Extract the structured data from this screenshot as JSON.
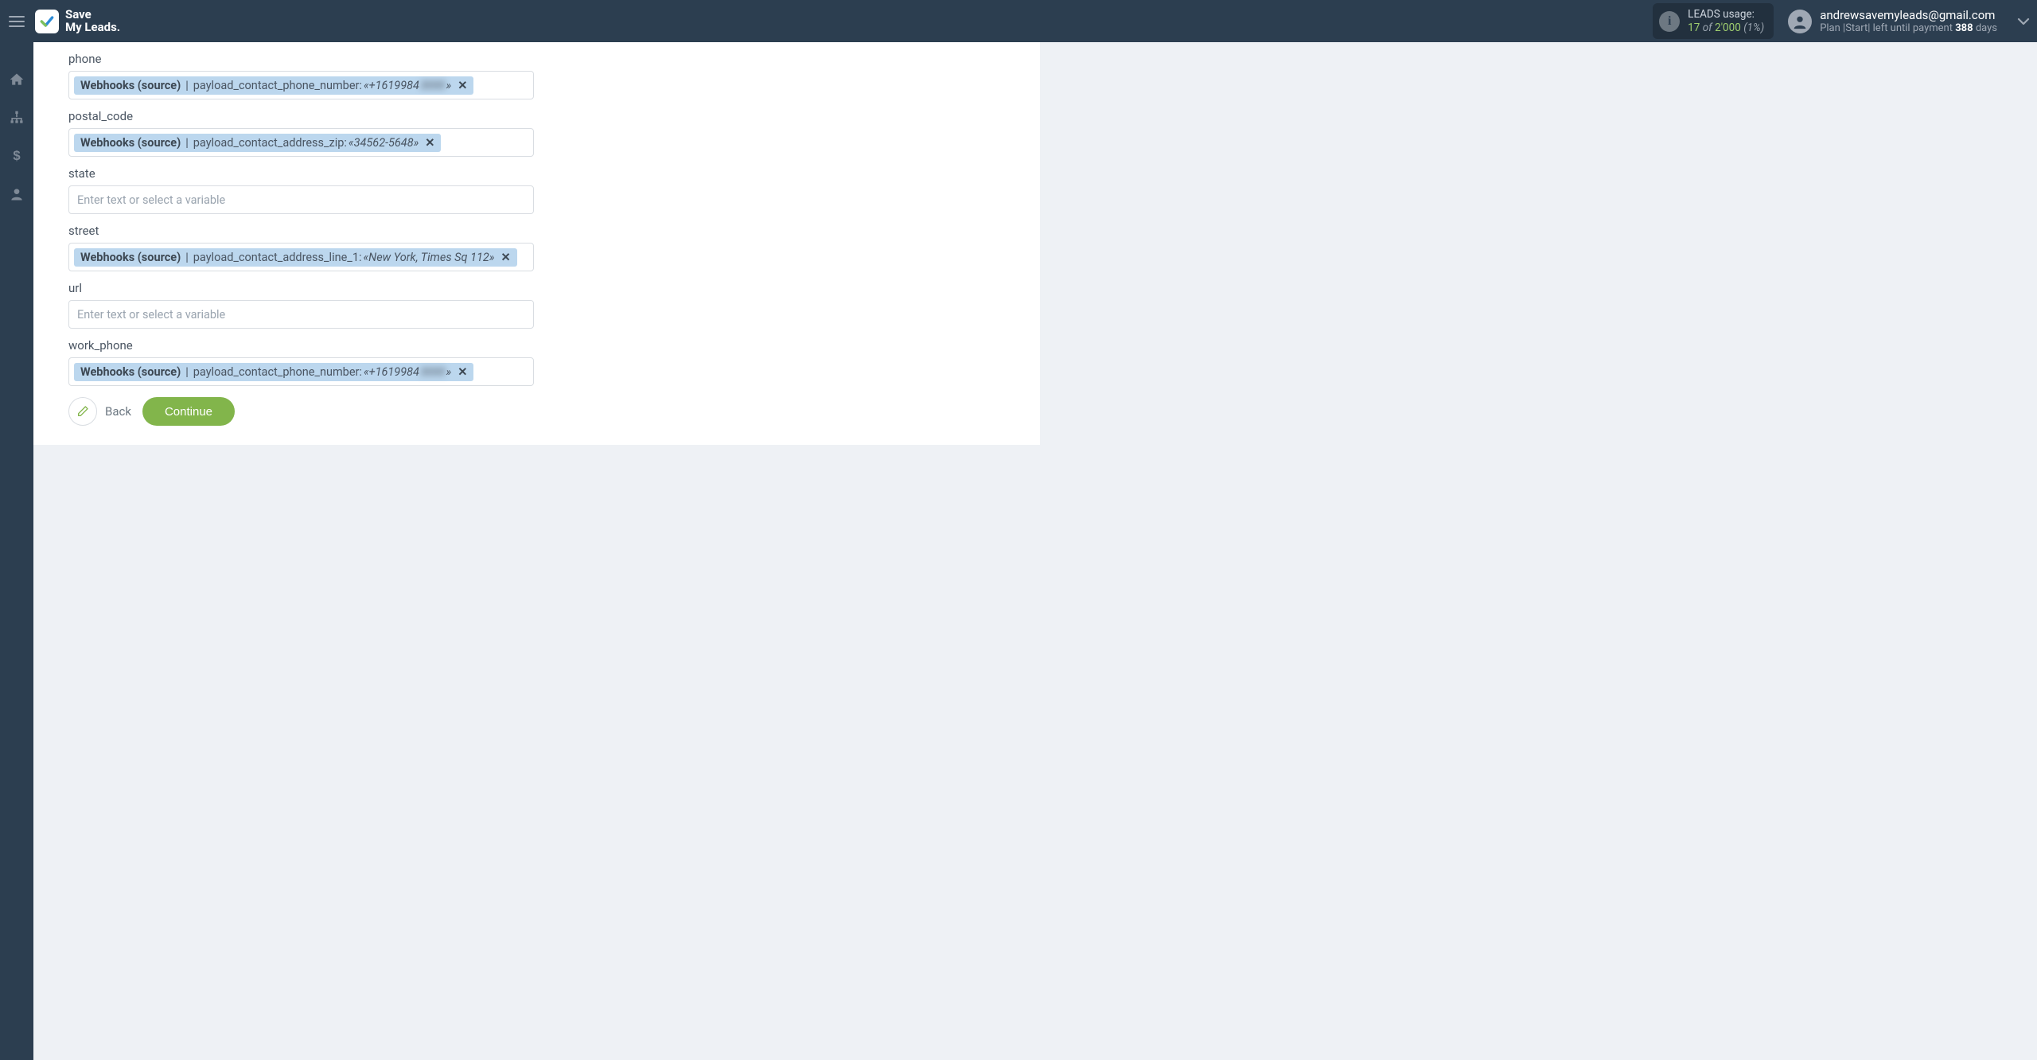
{
  "brand": {
    "line1": "Save",
    "line2": "My Leads."
  },
  "usage": {
    "title": "LEADS usage:",
    "used": "17",
    "of": "of",
    "cap": "2'000",
    "pct": "(1%)"
  },
  "account": {
    "email": "andrewsavemyleads@gmail.com",
    "plan_prefix": "Plan |Start| left until payment ",
    "days_number": "388",
    "days_suffix": " days"
  },
  "fields": {
    "phone": {
      "label": "phone",
      "chip_source": "Webhooks (source)",
      "chip_path": "payload_contact_phone_number:",
      "chip_example_prefix": "«+1619984",
      "chip_example_blur": "3000",
      "chip_example_suffix": "»",
      "remove": "✕"
    },
    "postal_code": {
      "label": "postal_code",
      "chip_source": "Webhooks (source)",
      "chip_path": "payload_contact_address_zip:",
      "chip_example": "«34562-5648»",
      "remove": "✕"
    },
    "state": {
      "label": "state",
      "placeholder": "Enter text or select a variable"
    },
    "street": {
      "label": "street",
      "chip_source": "Webhooks (source)",
      "chip_path": "payload_contact_address_line_1:",
      "chip_example": "«New York, Times Sq 112»",
      "remove": "✕"
    },
    "url": {
      "label": "url",
      "placeholder": "Enter text or select a variable"
    },
    "work_phone": {
      "label": "work_phone",
      "chip_source": "Webhooks (source)",
      "chip_path": "payload_contact_phone_number:",
      "chip_example_prefix": "«+1619984",
      "chip_example_blur": "3000",
      "chip_example_suffix": "»",
      "remove": "✕"
    }
  },
  "actions": {
    "back": "Back",
    "continue": "Continue"
  }
}
